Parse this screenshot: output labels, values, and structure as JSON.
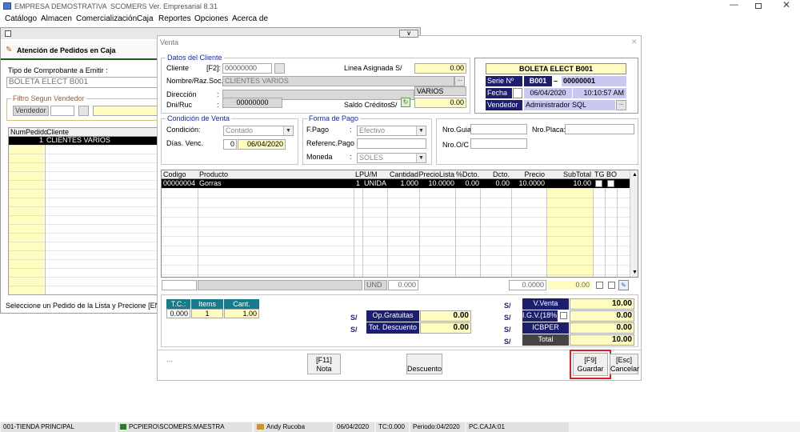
{
  "app": {
    "title": "EMPRESA DEMOSTRATIVA",
    "version": "SCOMERS Ver. Empresarial  8.31"
  },
  "menu": [
    "Catálogo",
    "Almacen",
    "Comercialización",
    "Caja",
    "Reportes",
    "Opciones",
    "Acerca de"
  ],
  "left_panel": {
    "title": "Atención de Pedidos en Caja",
    "tipo_label": "Tipo de Comprobante a Emitir :",
    "tipo_value": "BOLETA ELECT B001",
    "filtro_title": "Filtro Segun Vendedor",
    "vendedor_label": "Vendedor",
    "columns": [
      "NumPedido",
      "Cliente"
    ],
    "rows": [
      {
        "num": "1",
        "cliente": "CLIENTES VARIOS"
      }
    ],
    "status": "Seleccione un Pedido de la Lista y Precione [ENTER]"
  },
  "venta": {
    "title": "Venta",
    "datos_cliente": {
      "title": "Datos del Cliente",
      "cliente_label": "Cliente",
      "f2_label": "[F2]:",
      "cliente_code": "00000000",
      "nombre_label": "Nombre/Raz.Soc. :",
      "nombre_value": "CLIENTES VARIOS",
      "direccion_label": "Dirección",
      "direccion_extra": "VARIOS",
      "dni_label": "Dni/Ruc",
      "dni_value": "00000000",
      "linea_label": "Linea Asignada  S/",
      "linea_value": "0.00",
      "saldo_label": "Saldo Créditos",
      "saldo_currency": "S/",
      "saldo_value": "0.00"
    },
    "doc": {
      "title": "BOLETA ELECT B001",
      "serie_label": "Serie Nº",
      "serie": "B001",
      "numero": "00000001",
      "fecha_label": "Fecha",
      "fecha": "06/04/2020",
      "hora": "10:10:57 AM",
      "vendedor_label": "Vendedor",
      "vendedor": "Administrador SQL"
    },
    "condicion": {
      "title": "Condición de Venta",
      "condicion_label": "Condición",
      "condicion_value": "Contado",
      "dias_label": "Días. Venc.",
      "dias_value": "0",
      "venc_date": "06/04/2020"
    },
    "forma_pago": {
      "title": "Forma de Pago",
      "fpago_label": "F.Pago",
      "fpago_value": "Efectivo",
      "referenc_label": "Referenc.Pago",
      "moneda_label": "Moneda",
      "moneda_value": "SOLES"
    },
    "guia": {
      "nro_guia_label": "Nro.Guia:",
      "nro_oc_label": "Nro.O/C :",
      "nro_placa_label": "Nro.Placa:"
    },
    "grid": {
      "columns": [
        "Codigo",
        "Producto",
        "LP",
        "U/M",
        "Cantidad",
        "PrecioLista",
        "%Dcto.",
        "Dcto.",
        "Precio",
        "SubTotal",
        "TG",
        "BO"
      ],
      "rows": [
        {
          "codigo": "00000004",
          "producto": "Gorras",
          "lp": "1",
          "um": "UNIDA",
          "cantidad": "1.000",
          "precio_lista": "10.0000",
          "pdcto": "0.00",
          "dcto": "0.00",
          "precio": "10.0000",
          "subtotal": "10.00"
        }
      ],
      "footer": {
        "und": "UND",
        "cantidad": "0.000",
        "precio": "0.0000",
        "subtotal": "0.00"
      }
    },
    "summary": {
      "tc_label": "T.C.:",
      "items_label": "Items",
      "cant_label": "Cant.",
      "tc_value": "0.000",
      "items_value": "1",
      "cant_value": "1.00",
      "currency": "S/",
      "op_gratuitas_label": "Op.Gratuitas",
      "op_gratuitas_value": "0.00",
      "tot_descuento_label": "Tot. Descuento",
      "tot_descuento_value": "0.00",
      "v_venta_label": "V.Venta",
      "v_venta_value": "10.00",
      "igv_label": "I.G.V.(18%)",
      "igv_value": "0.00",
      "icbper_label": "ICBPER",
      "icbper_value": "0.00",
      "total_label": "Total",
      "total_value": "10.00"
    },
    "buttons": {
      "dots": "...",
      "nota_key": "[F11]",
      "nota": "Nota",
      "descuento": "Descuento",
      "guardar_key": "[F9]",
      "guardar": "Guardar",
      "cancelar_key": "[Esc]",
      "cancelar": "Cancelar"
    }
  },
  "statusbar": [
    "001-TIENDA PRINCIPAL",
    "PCPIERO\\SCOMERS:MAESTRA",
    "Andy Rucoba",
    "06/04/2020",
    "TC:0.000",
    "Periodo:04/2020",
    "PC.CAJA:01"
  ],
  "colors": {
    "navy": "#1c1e6e",
    "teal": "#147c8c",
    "yellow": "#fffcc0",
    "highlight": "#e02020"
  }
}
